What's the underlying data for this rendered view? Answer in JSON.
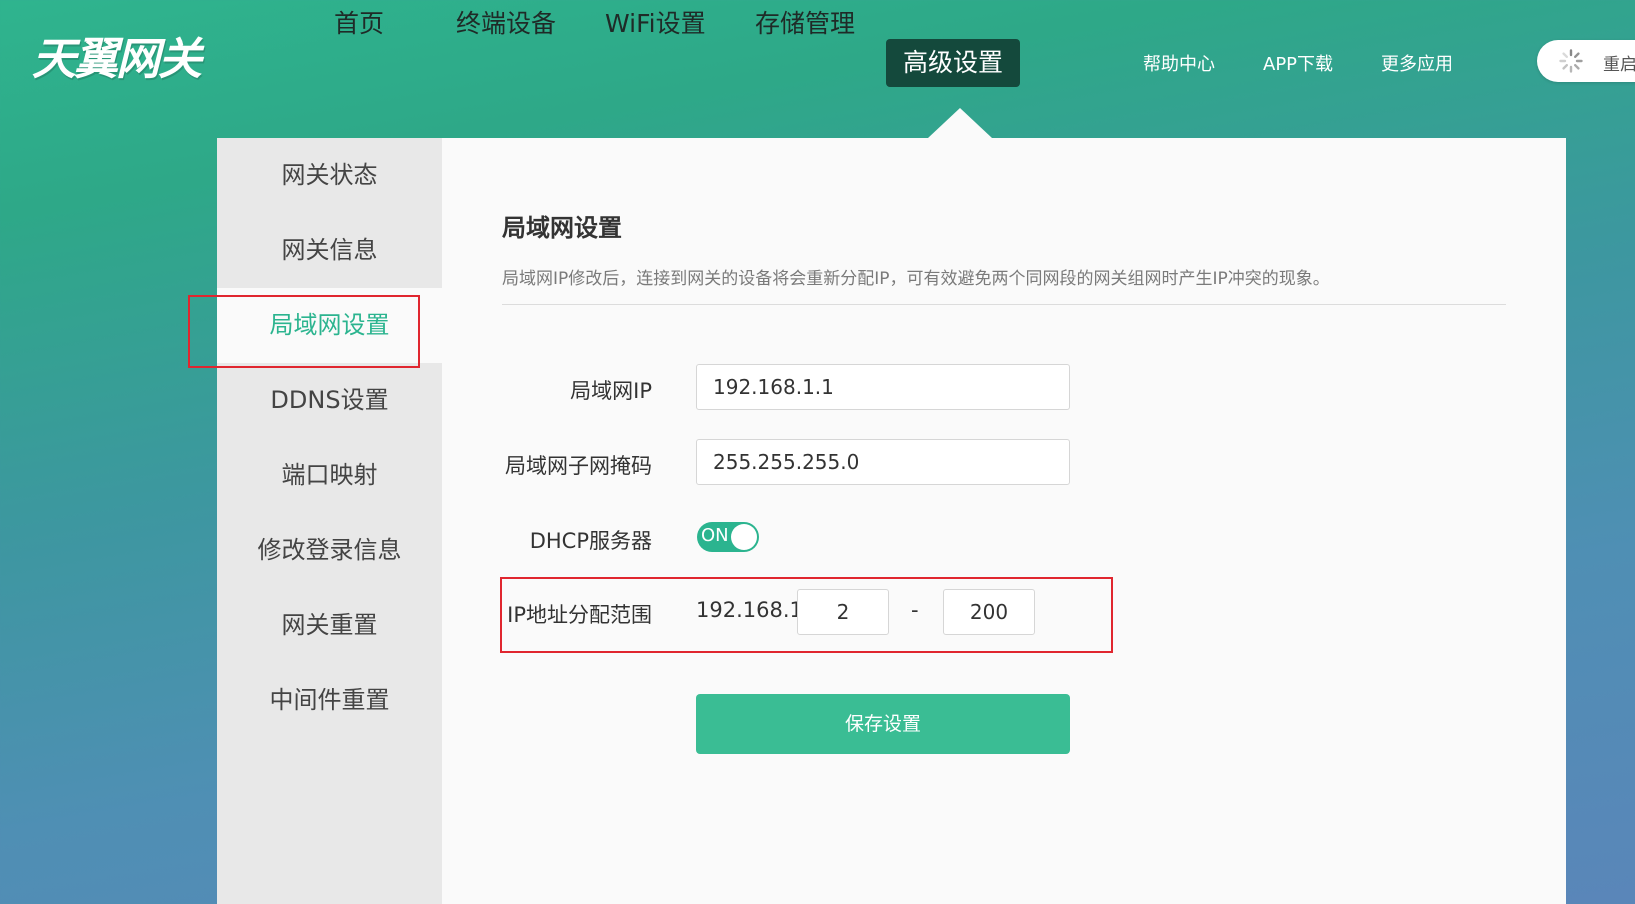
{
  "header": {
    "logo": "天翼网关",
    "nav": [
      "首页",
      "终端设备",
      "WiFi设置",
      "存储管理",
      "高级设置"
    ],
    "active_nav": "高级设置",
    "links": [
      "帮助中心",
      "APP下载",
      "更多应用"
    ],
    "reboot_label": "重启"
  },
  "sidebar": {
    "items": [
      "网关状态",
      "网关信息",
      "局域网设置",
      "DDNS设置",
      "端口映射",
      "修改登录信息",
      "网关重置",
      "中间件重置"
    ],
    "active": "局域网设置"
  },
  "section": {
    "title": "局域网设置",
    "description": "局域网IP修改后，连接到网关的设备将会重新分配IP，可有效避免两个同网段的网关组网时产生IP冲突的现象。"
  },
  "form": {
    "lan_ip_label": "局域网IP",
    "lan_ip_value": "192.168.1.1",
    "subnet_label": "局域网子网掩码",
    "subnet_value": "255.255.255.0",
    "dhcp_label": "DHCP服务器",
    "dhcp_state": "ON",
    "range_label": "IP地址分配范围",
    "range_prefix": "192.168.1.",
    "range_start": "2",
    "range_separator": "-",
    "range_end": "200",
    "save_label": "保存设置"
  },
  "colors": {
    "accent": "#3abd94",
    "nav_active": "#14493c",
    "highlight_box": "#e0262f"
  }
}
